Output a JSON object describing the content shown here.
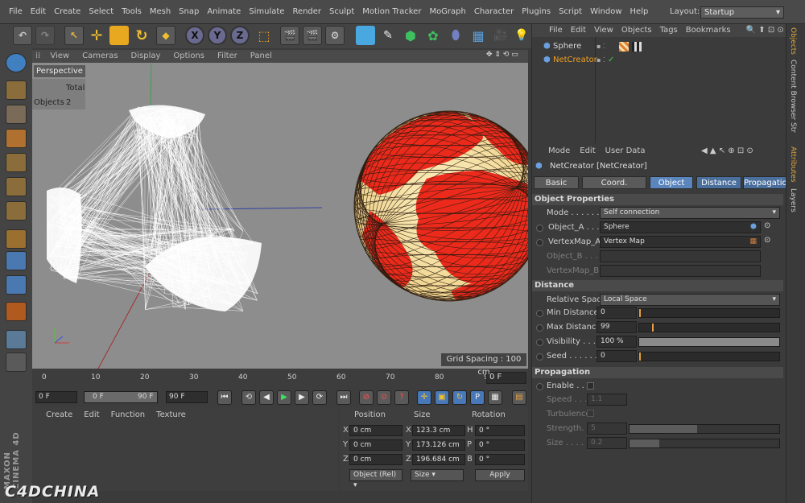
{
  "menubar": {
    "items": [
      "File",
      "Edit",
      "Create",
      "Select",
      "Tools",
      "Mesh",
      "Snap",
      "Animate",
      "Simulate",
      "Render",
      "Sculpt",
      "Motion Tracker",
      "MoGraph",
      "Character",
      "Plugins",
      "Script",
      "Window",
      "Help"
    ],
    "layout_label": "Layout:",
    "layout_value": "Startup"
  },
  "toolbar": {
    "axes": [
      "X",
      "Y",
      "Z"
    ]
  },
  "viewport": {
    "menu": [
      "View",
      "Cameras",
      "Display",
      "Options",
      "Filter",
      "Panel"
    ],
    "camera": "Perspective",
    "stats_header": "Total",
    "stats_label": "Objects",
    "stats_value": "2",
    "grid_spacing": "Grid Spacing : 100 cm"
  },
  "timeline": {
    "ticks": [
      "0",
      "10",
      "20",
      "30",
      "40",
      "50",
      "60",
      "70",
      "80",
      "90"
    ],
    "current_frame": "0 F",
    "progress": 0
  },
  "transport": {
    "start": "0 F",
    "range_start": "0 F",
    "range_end": "90 F",
    "end": "90 F"
  },
  "material_manager": {
    "menu": [
      "Create",
      "Edit",
      "Function",
      "Texture"
    ]
  },
  "coordinates": {
    "headers": [
      "Position",
      "Size",
      "Rotation"
    ],
    "rows": [
      {
        "axis": "X",
        "pos": "0 cm",
        "size_axis": "X",
        "size": "123.3 cm",
        "rot_axis": "H",
        "rot": "0 °"
      },
      {
        "axis": "Y",
        "pos": "0 cm",
        "size_axis": "Y",
        "size": "173.126 cm",
        "rot_axis": "P",
        "rot": "0 °"
      },
      {
        "axis": "Z",
        "pos": "0 cm",
        "size_axis": "Z",
        "size": "196.684 cm",
        "rot_axis": "B",
        "rot": "0 °"
      }
    ],
    "mode": "Object (Rel)",
    "size_mode": "Size",
    "apply": "Apply"
  },
  "objects": {
    "menu": [
      "File",
      "Edit",
      "View",
      "Objects",
      "Tags",
      "Bookmarks"
    ],
    "items": [
      {
        "name": "Sphere",
        "color": "#d8d8d8"
      },
      {
        "name": "NetCreator",
        "color": "#f0a020"
      }
    ]
  },
  "attributes": {
    "menu": [
      "Mode",
      "Edit",
      "User Data"
    ],
    "title": "NetCreator [NetCreator]",
    "tabs": [
      "Basic",
      "Coord.",
      "Object",
      "Distance",
      "Propagation"
    ],
    "sections": {
      "object": "Object Properties",
      "distance": "Distance",
      "propagation": "Propagation"
    },
    "mode_label": "Mode . . . . . . . .",
    "mode_value": "Self connection",
    "object_a_label": "Object_A . . . .",
    "object_a_value": "Sphere",
    "vertexmap_a_label": "VertexMap_A",
    "vertexmap_a_value": "Vertex Map",
    "object_b_label": "Object_B . . . .",
    "vertexmap_b_label": "VertexMap_B. .",
    "relative_space_label": "Relative Space",
    "relative_space_value": "Local Space",
    "min_distance_label": "Min Distance",
    "min_distance_value": "0",
    "min_distance_level": 0,
    "max_distance_label": "Max Distance",
    "max_distance_value": "99",
    "max_distance_level": 0.09,
    "visibility_label": "Visibility . . . .",
    "visibility_value": "100 %",
    "visibility_level": 1.0,
    "seed_label": "Seed . . . . . . .",
    "seed_value": "0",
    "seed_level": 0,
    "enable_label": "Enable . . .",
    "speed_label": "Speed . . . . .",
    "speed_value": "1.1",
    "turbulence_label": "Turbulence",
    "strength_label": "Strength. . . .",
    "strength_value": "5",
    "size_label": "Size . . . . . .",
    "size_value": "0.2"
  },
  "right_tabs": [
    "Objects",
    "Content Browser",
    "Str",
    "Attributes",
    "Layers"
  ],
  "branding": {
    "maxon": "MAXON CINEMA 4D",
    "watermark": "C4DCHINA"
  },
  "colors": {
    "accent": "#4b6f9c",
    "sphere_red": "#e8271b",
    "sphere_cream": "#f5e6a8",
    "viewport_bg": "#8a8a8a"
  }
}
